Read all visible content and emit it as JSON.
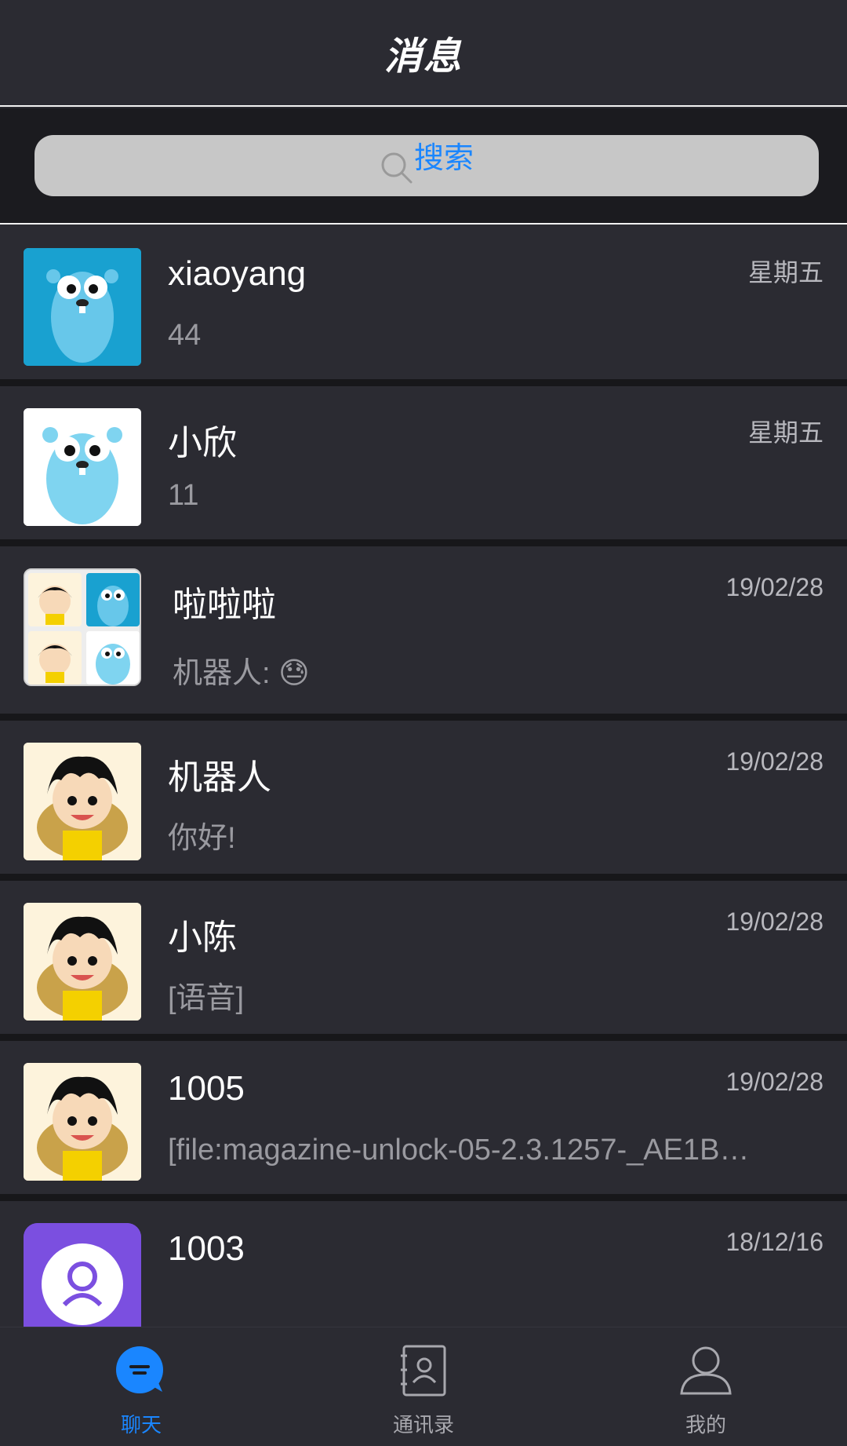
{
  "header": {
    "title": "消息"
  },
  "search": {
    "label": "搜索"
  },
  "conversations": [
    {
      "name": "xiaoyang",
      "message": "44",
      "time": "星期五",
      "avatar": "gopher-blue-icon"
    },
    {
      "name": "小欣",
      "message": "11",
      "time": "星期五",
      "avatar": "gopher-white-icon"
    },
    {
      "name": "啦啦啦",
      "message": "机器人: 😓",
      "time": "19/02/28",
      "avatar": "group-avatar-icon"
    },
    {
      "name": "机器人",
      "message": "你好!",
      "time": "19/02/28",
      "avatar": "cartoon-boy-icon"
    },
    {
      "name": "小陈",
      "message": "[语音]",
      "time": "19/02/28",
      "avatar": "cartoon-boy-icon"
    },
    {
      "name": "1005",
      "message": "[file:magazine-unlock-05-2.3.1257-_AE1B…",
      "time": "19/02/28",
      "avatar": "cartoon-boy-icon"
    },
    {
      "name": "1003",
      "message": "",
      "time": "18/12/16",
      "avatar": "purple-logo-icon"
    }
  ],
  "tabs": [
    {
      "label": "聊天",
      "icon": "chat-icon",
      "active": true
    },
    {
      "label": "通讯录",
      "icon": "contacts-icon",
      "active": false
    },
    {
      "label": "我的",
      "icon": "profile-icon",
      "active": false
    }
  ],
  "colors": {
    "accent": "#1a86ff",
    "background": "#2b2b32",
    "separator": "#17171a"
  }
}
